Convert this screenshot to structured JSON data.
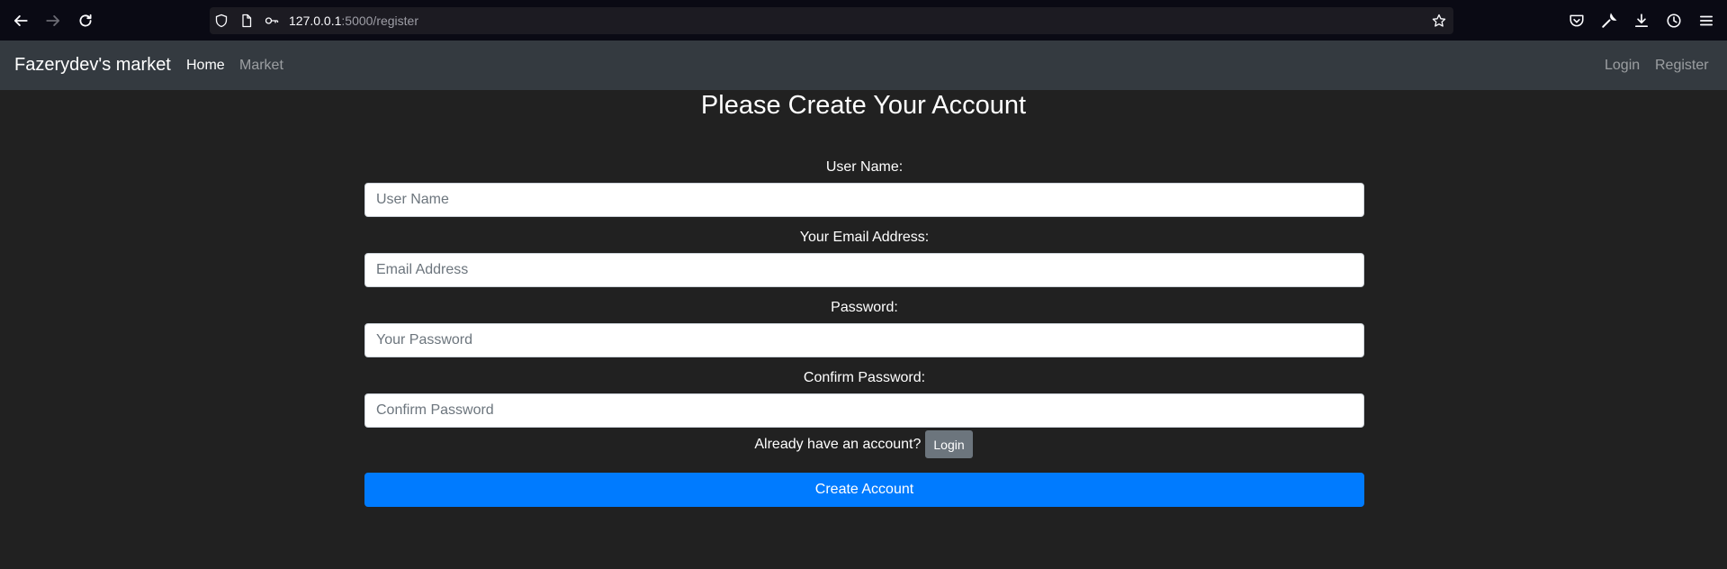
{
  "browser": {
    "url_host": "127.0.0.1",
    "url_path": ":5000/register",
    "icons": {
      "back": "back-arrow-icon",
      "forward": "forward-arrow-icon",
      "reload": "reload-icon",
      "shield": "shield-icon",
      "page": "page-icon",
      "key": "key-icon",
      "star": "star-icon",
      "pocket": "pocket-icon",
      "tools": "wrench-icon",
      "downloads": "download-icon",
      "history": "history-icon",
      "menu": "hamburger-menu-icon"
    }
  },
  "navbar": {
    "brand": "Fazerydev's market",
    "links": [
      {
        "label": "Home"
      },
      {
        "label": "Market"
      }
    ],
    "right_links": [
      {
        "label": "Login"
      },
      {
        "label": "Register"
      }
    ]
  },
  "form": {
    "title": "Please Create Your Account",
    "fields": [
      {
        "label": "User Name:",
        "placeholder": "User Name",
        "value": ""
      },
      {
        "label": "Your Email Address:",
        "placeholder": "Email Address",
        "value": ""
      },
      {
        "label": "Password:",
        "placeholder": "Your Password",
        "value": ""
      },
      {
        "label": "Confirm Password:",
        "placeholder": "Confirm Password",
        "value": ""
      }
    ],
    "already_text": "Already have an account?",
    "login_button": "Login",
    "submit_button": "Create Account"
  },
  "colors": {
    "page_bg": "#212121",
    "navbar_bg": "#343a40",
    "primary": "#007bff",
    "secondary": "#6c757d"
  }
}
